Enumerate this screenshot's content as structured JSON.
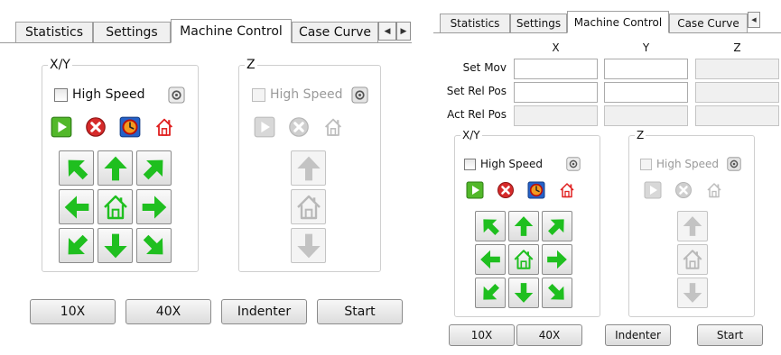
{
  "tabs": [
    "Statistics",
    "Settings",
    "Machine Control",
    "Case Curve"
  ],
  "active_tab": "Machine Control",
  "xy_group_label": "X/Y",
  "z_group_label": "Z",
  "high_speed_label": "High Speed",
  "buttons": {
    "b10x": "10X",
    "b40x": "40X",
    "indenter": "Indenter",
    "start": "Start"
  },
  "grid": {
    "columns": [
      "X",
      "Y",
      "Z"
    ],
    "rows": [
      "Set Mov",
      "Set Rel Pos",
      "Act Rel Pos"
    ]
  },
  "icons": {
    "xy_controls": [
      "play-icon",
      "stop-icon",
      "clock-icon",
      "home-icon"
    ],
    "z_controls": [
      "play-icon",
      "stop-icon",
      "home-icon"
    ],
    "xy_arrows": [
      "arrow-up-left-icon",
      "arrow-up-icon",
      "arrow-up-right-icon",
      "arrow-left-icon",
      "home-icon",
      "arrow-right-icon",
      "arrow-down-left-icon",
      "arrow-down-icon",
      "arrow-down-right-icon"
    ],
    "z_arrows": [
      "arrow-up-icon",
      "home-icon",
      "arrow-down-icon"
    ]
  },
  "colors": {
    "arrow_green": "#1fbf1f",
    "play_green": "#52b82a",
    "stop_red": "#d62a2a",
    "home_red": "#e02020"
  }
}
